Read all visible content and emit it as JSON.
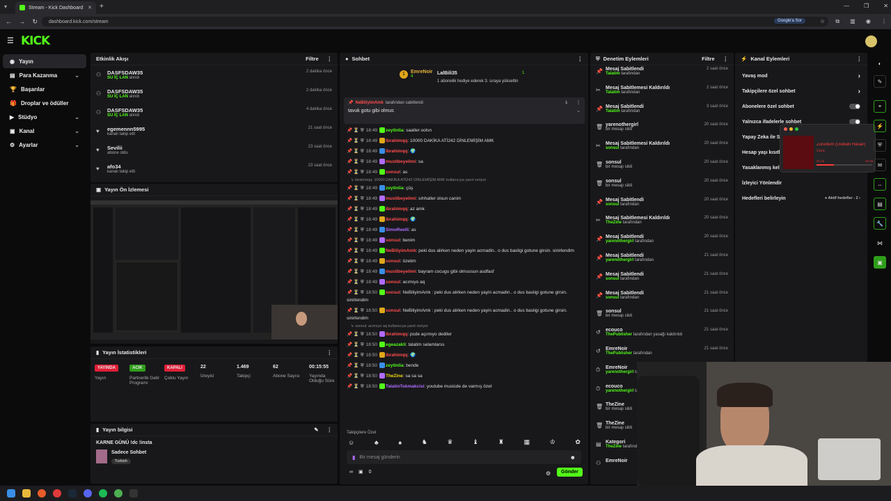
{
  "browser": {
    "tab_title": "Stream - Kick Dashboard",
    "url": "dashboard.kick.com/stream",
    "google_btn": "Google'a Sor"
  },
  "logo": "KICK",
  "sidebar": [
    {
      "label": "Yayın",
      "active": true
    },
    {
      "label": "Para Kazanma",
      "chev": "⌄"
    },
    {
      "label": "Başarılar"
    },
    {
      "label": "Droplar ve ödüller"
    },
    {
      "label": "Stüdyo",
      "chev": "⌄"
    },
    {
      "label": "Kanal",
      "chev": "⌄"
    },
    {
      "label": "Ayarlar",
      "chev": "⌄"
    }
  ],
  "activity": {
    "title": "Etkinlik Akışı",
    "filter": "Filtre",
    "items": [
      {
        "who": "DASFSDAW35",
        "sub": "SU İÇ LAN",
        "subtail": " alındı",
        "time": "2 dakika önce"
      },
      {
        "who": "DASFSDAW35",
        "sub": "SU İÇ LAN",
        "subtail": " alındı",
        "time": "2 dakika önce"
      },
      {
        "who": "DASFSDAW35",
        "sub": "SU İÇ LAN",
        "subtail": " alındı",
        "time": "4 dakika önce"
      },
      {
        "who": "egemennn5995",
        "sub": "",
        "subtail": "kanalı takip etti",
        "time": "21 saat önce"
      },
      {
        "who": "Sevilii",
        "sub": "",
        "subtail": "abone oldu",
        "time": "23 saat önce"
      },
      {
        "who": "afo34",
        "sub": "",
        "subtail": "kanalı takip etti",
        "time": "23 saat önce"
      }
    ]
  },
  "preview": {
    "title": "Yayın Ön İzlemesi"
  },
  "stats": {
    "title": "Yayın İstatistikleri",
    "items": [
      {
        "value": "YAYINDA",
        "label": "Yayın",
        "color": "#e01e37"
      },
      {
        "value": "ACIK",
        "label": "Partnerlik Gelir Programı",
        "color": "#2f9e1a"
      },
      {
        "value": "KAPALI",
        "label": "Çoklu Yayın",
        "color": "#e01e37"
      },
      {
        "value": "22",
        "label": "İzleyici"
      },
      {
        "value": "1.469",
        "label": "Takipçi"
      },
      {
        "value": "62",
        "label": "Abone Sayısı"
      },
      {
        "value": "00:15:55",
        "label": "Yayında Olduğu Süre"
      }
    ]
  },
  "info": {
    "title": "Yayın bilgisi",
    "stream_title": "KARNE GÜNÜ !dc !insta",
    "category": "Sadece Sohbet",
    "tag": "Turkish"
  },
  "chat": {
    "title": "Sohbet",
    "top_gifter": {
      "name": "EmreNoir",
      "count": "4",
      "name2": "LalBili35",
      "count2": "1",
      "note": "1 abonelik hediye ederek 3. sıraya yükseltin"
    },
    "pinned": {
      "by": "NeBiliyimAmk",
      "by_tail": " tarafından sabitlendi",
      "text": "tavuk gotu gibi olmus"
    },
    "lines": [
      {
        "t": "18:49",
        "u": "zeytinlia",
        "c": "#53fc18",
        "m": "saatler oolsn"
      },
      {
        "t": "18:49",
        "u": "ibrahimqq",
        "c": "#ff4d4d",
        "m": "10000 DAKİKA ATİ242 DİNLEMİŞİM AMK"
      },
      {
        "t": "18:49",
        "u": "ibrahimqq",
        "c": "#ff4d4d",
        "m": "🌍"
      },
      {
        "t": "18:49",
        "u": "mustibeyelimi",
        "c": "#ff4d4d",
        "m": "sa"
      },
      {
        "t": "18:49",
        "u": "sonsul",
        "c": "#ff4d4d",
        "m": "as"
      },
      {
        "reply": "ibrahimqq: 10000 DAKİKA ATİ242 DİNLEMİŞİM AMK kullanıcıya yanıt veriyor"
      },
      {
        "t": "18:49",
        "u": "zeytinlia",
        "c": "#53fc18",
        "m": "çüş"
      },
      {
        "t": "18:49",
        "u": "mustibeyelimi",
        "c": "#ff4d4d",
        "m": "sıhhatler olsun canim"
      },
      {
        "t": "18:49",
        "u": "ibrahimqq",
        "c": "#ff4d4d",
        "m": "az amk"
      },
      {
        "t": "18:49",
        "u": "ibrahimqq",
        "c": "#ff4d4d",
        "m": "🌍"
      },
      {
        "t": "18:49",
        "u": "SimoReelli",
        "c": "#b06cff",
        "m": "as"
      },
      {
        "t": "18:49",
        "u": "sonsul",
        "c": "#ff4d4d",
        "m": "benim"
      },
      {
        "t": "18:49",
        "u": "NeBiliyimAmk",
        "c": "#ff4d4d",
        "m": "peki dus alirken neden yayin acmadin.. o dus basligi gotune girsin. sinirlendim"
      },
      {
        "t": "18:49",
        "u": "sonsul",
        "c": "#ff4d4d",
        "m": "özetim"
      },
      {
        "t": "18:49",
        "u": "mustibeyelimi",
        "c": "#ff4d4d",
        "m": "bayram cocugu gibi olmussun asdfasf"
      },
      {
        "t": "18:49",
        "u": "sonsul",
        "c": "#ff4d4d",
        "m": "acımıyo aq"
      },
      {
        "t": "18:50",
        "u": "sonsul",
        "c": "#ff4d4d",
        "m": "NeBiliyimAmk : peki dus alirken neden yayin acmadin.. o dus basligi gotune girsin. sinirlendim"
      },
      {
        "t": "18:50",
        "u": "sonsul",
        "c": "#ff4d4d",
        "m": "NeBiliyimAmk : peki dus alirken neden yayin acmadin.. o dus basligi gotune girsin. sinirlendim"
      },
      {
        "reply": "sonsul: acımıyo aq kullanıcıya yanıt veriyor"
      },
      {
        "t": "18:50",
        "u": "ibrahimqq",
        "c": "#ff4d4d",
        "m": "pcde açımıyo dediler"
      },
      {
        "t": "18:50",
        "u": "egeazakli",
        "c": "#53fc18",
        "m": "talatim selamlarss"
      },
      {
        "t": "18:50",
        "u": "ibrahimqq",
        "c": "#ff4d4d",
        "m": "🌍"
      },
      {
        "t": "18:50",
        "u": "zeytinlia",
        "c": "#53fc18",
        "m": "bende"
      },
      {
        "t": "18:50",
        "u": "TheZine",
        "c": "#f5d90a",
        "m": "sa sa sa"
      },
      {
        "t": "18:50",
        "u": "TalatinTokmakcisi",
        "c": "#b06cff",
        "m": "youtube musicde de varmış özet"
      }
    ],
    "followers_only": "Takipçilere Özel",
    "placeholder": "Bir mesaj gönderin",
    "send": "Gönder",
    "points": "0"
  },
  "modlog": {
    "title": "Denetim Eylemleri",
    "filter": "Filtre",
    "items": [
      {
        "icon": "pin",
        "who": "Mesaj Sabitlendi",
        "by": "Talatim",
        "tail": " tarafından",
        "time": "2 saat önce"
      },
      {
        "icon": "unpin",
        "who": "Mesaj Sabitlemesi Kaldırıldı",
        "by": "Talatim",
        "tail": " tarafından",
        "time": "2 saat önce"
      },
      {
        "icon": "pin",
        "who": "Mesaj Sabitlendi",
        "by": "Talatim",
        "tail": " tarafından",
        "time": "3 saat önce"
      },
      {
        "icon": "trash",
        "who": "yarenothergirl",
        "by": "",
        "tail": "bir mesajı sildi",
        "time": "20 saat önce"
      },
      {
        "icon": "unpin",
        "who": "Mesaj Sabitlemesi Kaldırıldı",
        "by": "sonsul",
        "tail": " tarafından",
        "time": "20 saat önce"
      },
      {
        "icon": "trash",
        "who": "sonsul",
        "by": "",
        "tail": "bir mesajı sildi",
        "time": "20 saat önce"
      },
      {
        "icon": "trash",
        "who": "sonsul",
        "by": "",
        "tail": "bir mesajı sildi",
        "time": "20 saat önce"
      },
      {
        "icon": "pin",
        "who": "Mesaj Sabitlendi",
        "by": "sonsul",
        "tail": " tarafından",
        "time": "20 saat önce"
      },
      {
        "icon": "unpin",
        "who": "Mesaj Sabitlemesi Kaldırıldı",
        "by": "TheZine",
        "tail": " tarafından",
        "time": "20 saat önce"
      },
      {
        "icon": "pin",
        "who": "Mesaj Sabitlendi",
        "by": "yarenothergirl",
        "tail": " tarafından",
        "time": "20 saat önce"
      },
      {
        "icon": "pin",
        "who": "Mesaj Sabitlendi",
        "by": "yarenothergirl",
        "tail": " tarafından",
        "time": "21 saat önce"
      },
      {
        "icon": "pin",
        "who": "Mesaj Sabitlendi",
        "by": "sonsul",
        "tail": " tarafından",
        "time": "21 saat önce"
      },
      {
        "icon": "pin",
        "who": "Mesaj Sabitlendi",
        "by": "sonsul",
        "tail": " tarafından",
        "time": "21 saat önce"
      },
      {
        "icon": "trash",
        "who": "sonsul",
        "by": "",
        "tail": "bir mesajı sildi",
        "time": "21 saat önce"
      },
      {
        "icon": "undo",
        "who": "ecouco",
        "by": "ThePublisher",
        "tail": " tarafından yasağı kaldırıldı",
        "time": "21 saat önce"
      },
      {
        "icon": "undo",
        "who": "EmreNoir",
        "by": "ThePublisher",
        "tail": " tarafından",
        "time": "21 saat önce"
      },
      {
        "icon": "clock",
        "who": "EmreNoir",
        "by": "yarenothergirl",
        "tail": " tarafından uzaklaştırıldı",
        "time": ""
      },
      {
        "icon": "clock",
        "who": "ecouco",
        "by": "yarenothergirl",
        "tail": " tarafından uzaklaştırıldı",
        "time": ""
      },
      {
        "icon": "trash",
        "who": "TheZine",
        "by": "",
        "tail": "bir mesajı sildi",
        "time": ""
      },
      {
        "icon": "trash",
        "who": "TheZine",
        "by": "",
        "tail": "bir mesajı sildi",
        "time": ""
      },
      {
        "icon": "cat",
        "who": "Kategori",
        "by": "TheZine",
        "tail": " tarafından",
        "time": ""
      },
      {
        "icon": "user",
        "who": "EmreNoir",
        "by": "",
        "tail": "",
        "time": ""
      }
    ]
  },
  "channel_actions": {
    "title": "Kanal Eylemleri",
    "items": [
      {
        "label": "Yavaş mod",
        "ctl": "chev"
      },
      {
        "label": "Takipçilere özel sohbet",
        "ctl": "chev"
      },
      {
        "label": "Abonelere özel sohbet",
        "ctl": "toggle"
      },
      {
        "label": "Yalnızca ifadelerle sohbet",
        "ctl": "toggle"
      },
      {
        "label": "Yapay Zeka ile Sohbet Moderasyonu",
        "ctl": ""
      },
      {
        "label": "Hesap yaşı kısıtlaması",
        "ctl": ""
      },
      {
        "label": "Yasaklanmış kelimeler",
        "ctl": ""
      },
      {
        "label": "İzleyici Yönlendir",
        "ctl": ""
      },
      {
        "label": "Hedefleri belirleyin",
        "ctl": "goal"
      }
    ],
    "goal_text": "Aktif hedefler - 2"
  },
  "media": {
    "title": "Zuruldum (Ulubatlı Hasan)",
    "artist": "Ceza",
    "elapsed": "01:10",
    "total": "03:46",
    "progress": 0.31
  }
}
